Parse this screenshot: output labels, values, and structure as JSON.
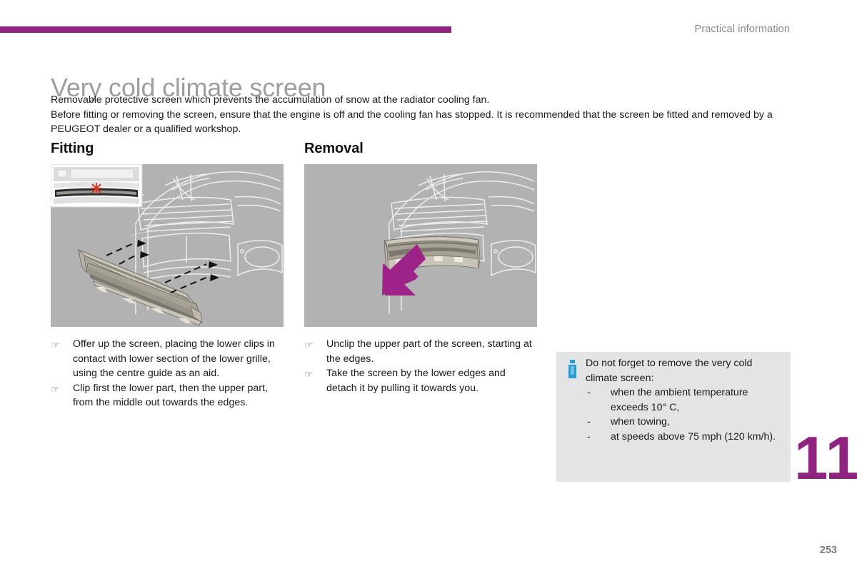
{
  "header": {
    "section_label": "Practical information",
    "rule_color": "#8e2480"
  },
  "page": {
    "title": "Very cold climate screen",
    "chapter_number": "11",
    "page_number": "253"
  },
  "intro": {
    "line1": "Removable protective screen which prevents the accumulation of snow at the radiator cooling fan.",
    "line2": "Before fitting or removing the screen, ensure that the engine is off and the cooling fan has stopped. It is recommended that the screen be fitted and removed by a PEUGEOT dealer or a qualified workshop."
  },
  "columns": {
    "fitting": {
      "heading": "Fitting",
      "figure_caption": "front-bumper-screen-fitting-diagram",
      "steps": [
        "Offer up the screen, placing the lower clips in contact with lower section of the lower grille, using the centre guide as an aid.",
        "Clip first the lower part, then the upper part, from the middle out towards the edges."
      ]
    },
    "removal": {
      "heading": "Removal",
      "figure_caption": "front-bumper-screen-removal-diagram",
      "steps": [
        "Unclip the upper part of the screen, starting at the edges.",
        "Take the screen by the lower edges and detach it by pulling it towards you."
      ]
    }
  },
  "info_box": {
    "icon": "information-icon",
    "icon_color": "#2e9ad0",
    "background": "#e3e4e5",
    "lead": "Do not forget to remove the very cold climate screen:",
    "dash": "-",
    "items": [
      "when the ambient temperature exceeds 10° C,",
      "when towing,",
      "at speeds above 75 mph (120 km/h)."
    ]
  },
  "markers": {
    "step_bullet": "☞"
  }
}
